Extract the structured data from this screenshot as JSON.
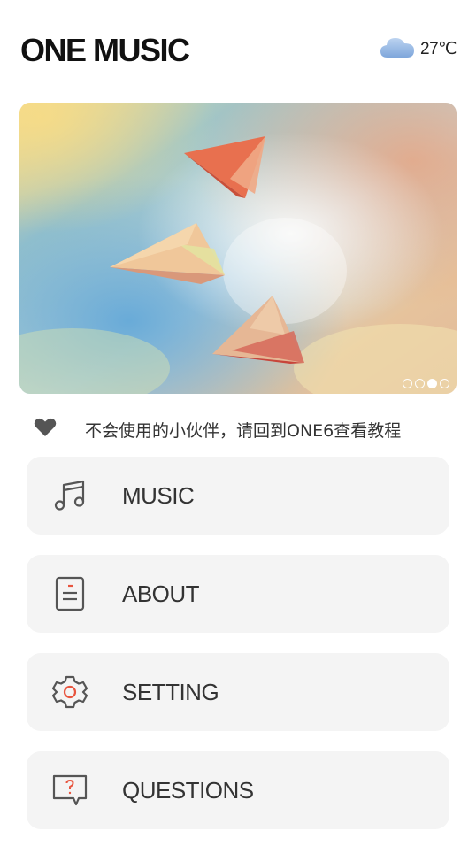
{
  "app": {
    "title": "ONE MUSIC"
  },
  "weather": {
    "temperature": "27℃",
    "icon": "cloud-icon"
  },
  "banner": {
    "image": "paper-planes-sky-illustration",
    "page_count": 4,
    "active_page": 3
  },
  "notice": {
    "icon": "heart-icon",
    "text": "不会使用的小伙伴，请回到ONE6查看教程"
  },
  "menu": {
    "items": [
      {
        "label": "MUSIC",
        "icon": "music-note-icon"
      },
      {
        "label": "ABOUT",
        "icon": "document-icon"
      },
      {
        "label": "SETTING",
        "icon": "gear-icon"
      },
      {
        "label": "QUESTIONS",
        "icon": "question-chat-icon"
      }
    ]
  },
  "colors": {
    "accent": "#e8553f",
    "icon": "#555555",
    "card": "#f4f4f4"
  }
}
